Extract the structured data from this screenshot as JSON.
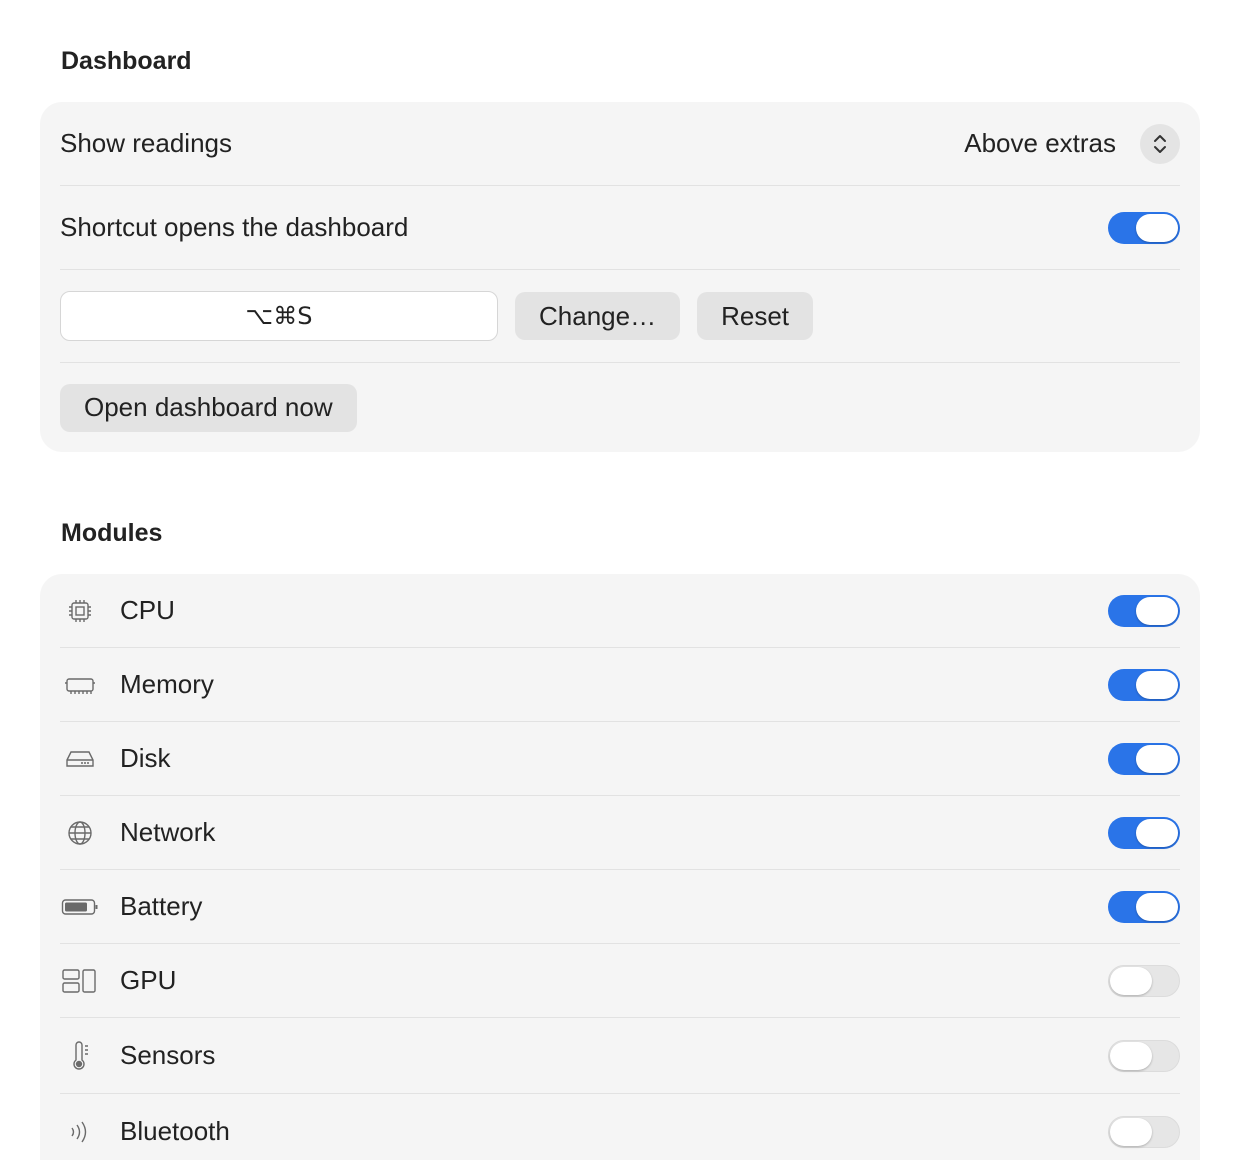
{
  "dashboard": {
    "title": "Dashboard",
    "show_readings_label": "Show readings",
    "show_readings_value": "Above extras",
    "shortcut_label": "Shortcut opens the dashboard",
    "shortcut_enabled": true,
    "shortcut_keys": "⌥⌘S",
    "change_label": "Change…",
    "reset_label": "Reset",
    "open_now_label": "Open dashboard now"
  },
  "modules": {
    "title": "Modules",
    "items": [
      {
        "label": "CPU",
        "icon": "cpu-icon",
        "enabled": true
      },
      {
        "label": "Memory",
        "icon": "memory-icon",
        "enabled": true
      },
      {
        "label": "Disk",
        "icon": "disk-icon",
        "enabled": true
      },
      {
        "label": "Network",
        "icon": "network-globe-icon",
        "enabled": true
      },
      {
        "label": "Battery",
        "icon": "battery-icon",
        "enabled": true
      },
      {
        "label": "GPU",
        "icon": "gpu-icon",
        "enabled": false
      },
      {
        "label": "Sensors",
        "icon": "thermometer-icon",
        "enabled": false
      },
      {
        "label": "Bluetooth",
        "icon": "bluetooth-waves-icon",
        "enabled": false
      }
    ]
  },
  "colors": {
    "accent": "#2a74e8",
    "card_background": "#f5f5f5",
    "toggle_off": "#e6e6e6"
  }
}
